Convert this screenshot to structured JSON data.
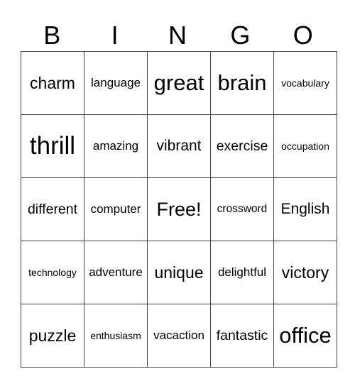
{
  "header": {
    "letters": [
      "B",
      "I",
      "N",
      "G",
      "O"
    ]
  },
  "rows": [
    [
      "charm",
      "language",
      "great",
      "brain",
      "vocabulary"
    ],
    [
      "thrill",
      "amazing",
      "vibrant",
      "exercise",
      "occupation"
    ],
    [
      "different",
      "computer",
      "Free!",
      "crossword",
      "English"
    ],
    [
      "technology",
      "adventure",
      "unique",
      "delightful",
      "victory"
    ],
    [
      "puzzle",
      "enthusiasm",
      "vacaction",
      "fantastic",
      "office"
    ]
  ]
}
